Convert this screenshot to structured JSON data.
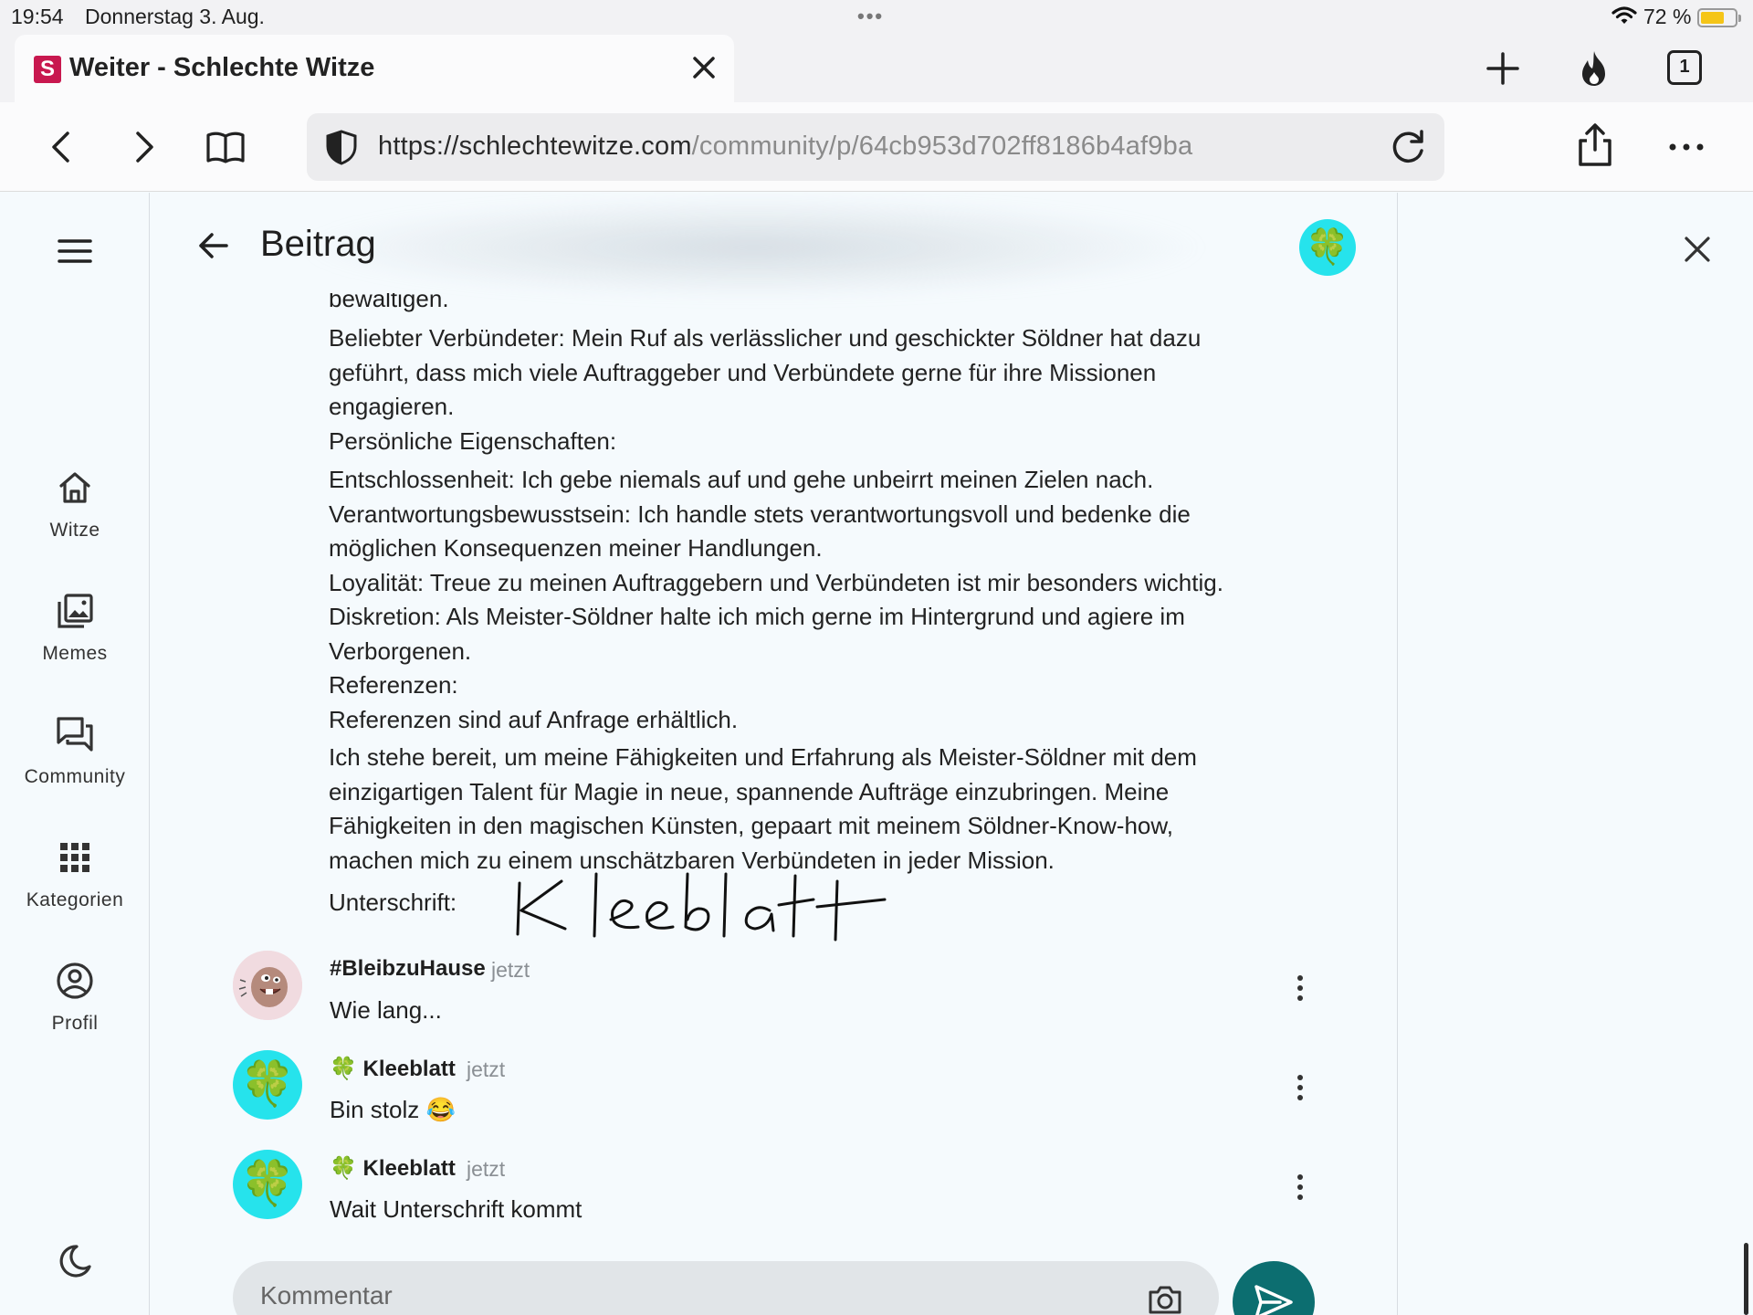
{
  "status_bar": {
    "time": "19:54",
    "date": "Donnerstag 3. Aug.",
    "battery": "72 %"
  },
  "browser": {
    "tab": {
      "favicon": "S",
      "title": "Weiter - Schlechte Witze"
    },
    "tab_count": "1",
    "url_host": "https://schlechtewitze.com",
    "url_path": "/community/p/64cb953d702ff8186b4af9ba"
  },
  "nav": {
    "items": [
      {
        "label": "Witze",
        "icon": "home-icon"
      },
      {
        "label": "Memes",
        "icon": "images-icon"
      },
      {
        "label": "Community",
        "icon": "forum-icon"
      },
      {
        "label": "Kategorien",
        "icon": "grid-icon"
      },
      {
        "label": "Profil",
        "icon": "account-icon"
      }
    ]
  },
  "post": {
    "title": "Beitrag",
    "cut_line": "bewältigen.",
    "lines_a": [
      "Beliebter Verbündeter: Mein Ruf als verlässlicher und geschickter Söldner hat dazu",
      "geführt, dass mich viele Auftraggeber und Verbündete gerne für ihre Missionen",
      "engagieren.",
      "Persönliche Eigenschaften:"
    ],
    "lines_b": [
      "Entschlossenheit: Ich gebe niemals auf und gehe unbeirrt meinen Zielen nach.",
      "Verantwortungsbewusstsein: Ich handle stets verantwortungsvoll und bedenke die",
      "möglichen Konsequenzen meiner Handlungen.",
      "Loyalität: Treue zu meinen Auftraggebern und Verbündeten ist mir besonders wichtig.",
      "Diskretion: Als Meister-Söldner halte ich mich gerne im Hintergrund und agiere im",
      "Verborgenen.",
      "Referenzen:",
      "Referenzen sind auf Anfrage erhältlich."
    ],
    "closing": "Ich stehe bereit, um meine Fähigkeiten und Erfahrung als Meister-Söldner mit dem einzigartigen Talent für Magie in neue, spannende Aufträge einzubringen. Meine Fähigkeiten in den magischen Künsten, gepaart mit meinem Söldner-Know-how, machen mich zu einem unschätzbaren Verbündeten in jeder Mission.",
    "signature_label": "Unterschrift:",
    "signature": "Kleeblatt"
  },
  "comments": [
    {
      "author": "#BleibzuHause",
      "time": "jetzt",
      "text": "Wie lang...",
      "avatar": "beaver-avatar"
    },
    {
      "author": "🍀 Kleeblatt",
      "time": "jetzt",
      "text": "Bin stolz 😂",
      "avatar": "clover-avatar"
    },
    {
      "author": "🍀 Kleeblatt",
      "time": "jetzt",
      "text": "Wait Unterschrift kommt",
      "avatar": "clover-avatar"
    }
  ],
  "composer": {
    "placeholder": "Kommentar"
  },
  "colors": {
    "accent": "#0c6e70",
    "avatar_bg": "#26e3ec",
    "favicon": "#c8184f"
  }
}
